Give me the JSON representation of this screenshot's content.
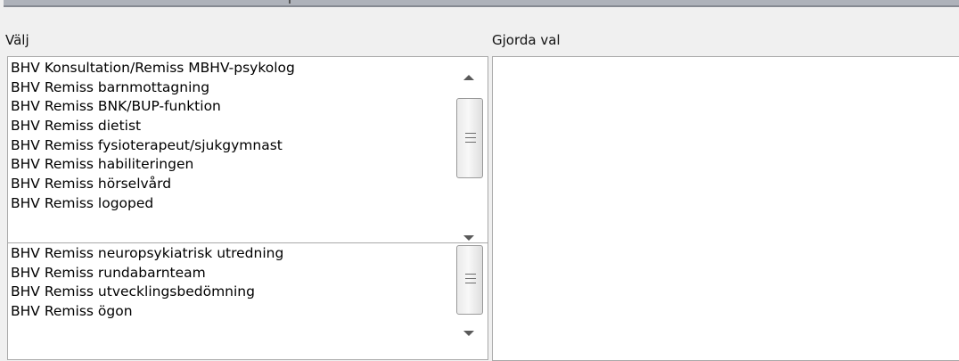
{
  "header": {
    "left_label": "Välj",
    "right_label": "Gjorda val"
  },
  "list_top": {
    "items": [
      "BHV Konsultation/Remiss MBHV-psykolog",
      "BHV Remiss barnmottagning",
      "BHV Remiss BNK/BUP-funktion",
      "BHV Remiss dietist",
      "BHV Remiss fysioterapeut/sjukgymnast",
      "BHV Remiss habiliteringen",
      "BHV Remiss hörselvård",
      "BHV Remiss logoped"
    ]
  },
  "list_bottom": {
    "items": [
      "BHV Remiss neuropsykiatrisk utredning",
      "BHV Remiss rundabarnteam",
      "BHV Remiss utvecklingsbedömning",
      "BHV Remiss ögon"
    ]
  },
  "selected": {
    "items": []
  },
  "icons": {
    "scroll_up": "scroll-up-arrow-icon",
    "scroll_down": "scroll-down-arrow-icon",
    "thumb_grip": "scroll-thumb-grip-icon"
  },
  "colors": {
    "background": "#f0f0f0",
    "list_background": "#ffffff",
    "border": "#a9a9a9",
    "top_bar": "#aeb2ba"
  }
}
